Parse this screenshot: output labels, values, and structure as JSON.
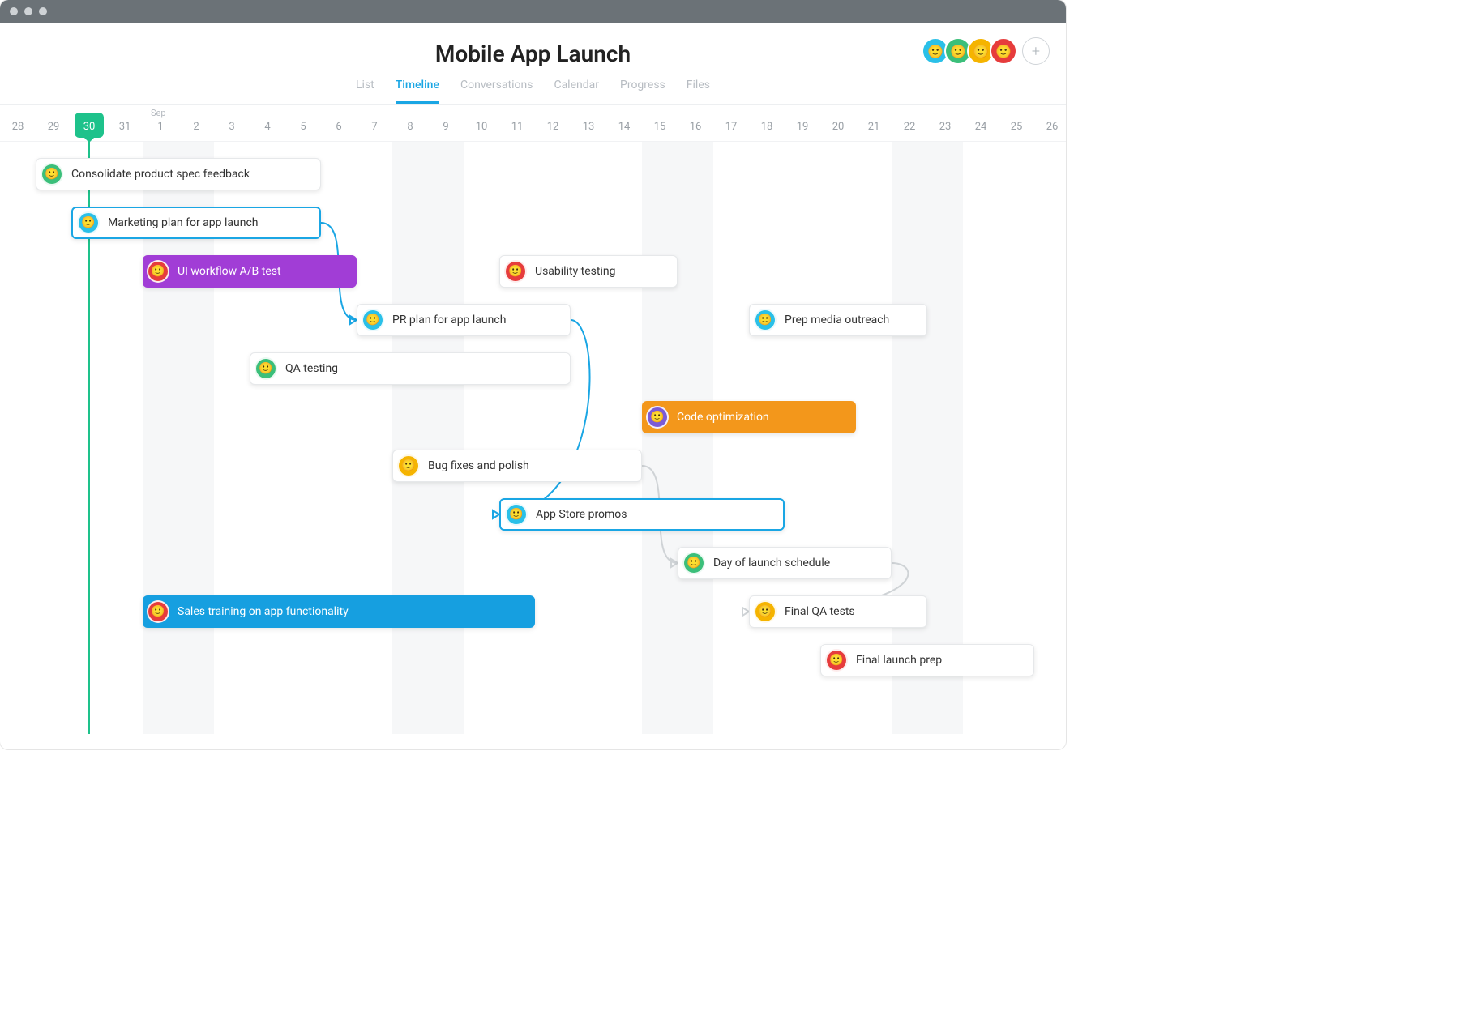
{
  "project_title": "Mobile App Launch",
  "tabs": [
    "List",
    "Timeline",
    "Conversations",
    "Calendar",
    "Progress",
    "Files"
  ],
  "active_tab": "Timeline",
  "month_label": "Sep",
  "dates": [
    {
      "label": "28",
      "weekend": false
    },
    {
      "label": "29",
      "weekend": false
    },
    {
      "label": "30",
      "weekend": false,
      "today": true
    },
    {
      "label": "31",
      "weekend": false
    },
    {
      "label": "1",
      "weekend": true,
      "month_start": true
    },
    {
      "label": "2",
      "weekend": true
    },
    {
      "label": "3",
      "weekend": false
    },
    {
      "label": "4",
      "weekend": false
    },
    {
      "label": "5",
      "weekend": false
    },
    {
      "label": "6",
      "weekend": false
    },
    {
      "label": "7",
      "weekend": false
    },
    {
      "label": "8",
      "weekend": true
    },
    {
      "label": "9",
      "weekend": true
    },
    {
      "label": "10",
      "weekend": false
    },
    {
      "label": "11",
      "weekend": false
    },
    {
      "label": "12",
      "weekend": false
    },
    {
      "label": "13",
      "weekend": false
    },
    {
      "label": "14",
      "weekend": false
    },
    {
      "label": "15",
      "weekend": true
    },
    {
      "label": "16",
      "weekend": true
    },
    {
      "label": "17",
      "weekend": false
    },
    {
      "label": "18",
      "weekend": false
    },
    {
      "label": "19",
      "weekend": false
    },
    {
      "label": "20",
      "weekend": false
    },
    {
      "label": "21",
      "weekend": false
    },
    {
      "label": "22",
      "weekend": true
    },
    {
      "label": "23",
      "weekend": true
    },
    {
      "label": "24",
      "weekend": false
    },
    {
      "label": "25",
      "weekend": false
    },
    {
      "label": "26",
      "weekend": false
    }
  ],
  "members": [
    {
      "color": "#2ac0e8"
    },
    {
      "color": "#3bbf7a"
    },
    {
      "color": "#f5b400"
    },
    {
      "color": "#e63c3c"
    }
  ],
  "tasks": [
    {
      "id": "t1",
      "label": "Consolidate product spec feedback",
      "row": 0,
      "start": 1,
      "span": 8,
      "style": "white",
      "avatar": "#3bbf7a"
    },
    {
      "id": "t2",
      "label": "Marketing plan for app launch",
      "row": 1,
      "start": 2,
      "span": 7,
      "style": "highlight",
      "avatar": "#2ac0e8"
    },
    {
      "id": "t3",
      "label": "UI workflow A/B test",
      "row": 2,
      "start": 4,
      "span": 6,
      "style": "purple",
      "avatar": "#e63c3c"
    },
    {
      "id": "t4",
      "label": "Usability testing",
      "row": 2,
      "start": 14,
      "span": 5,
      "style": "white",
      "avatar": "#e63c3c"
    },
    {
      "id": "t5",
      "label": "PR plan for app launch",
      "row": 3,
      "start": 10,
      "span": 6,
      "style": "white",
      "avatar": "#2ac0e8"
    },
    {
      "id": "t6",
      "label": "Prep media outreach",
      "row": 3,
      "start": 21,
      "span": 5,
      "style": "white",
      "avatar": "#2ac0e8"
    },
    {
      "id": "t7",
      "label": "QA testing",
      "row": 4,
      "start": 7,
      "span": 9,
      "style": "white",
      "avatar": "#3bbf7a"
    },
    {
      "id": "t8",
      "label": "Code optimization",
      "row": 5,
      "start": 18,
      "span": 6,
      "style": "orange",
      "avatar": "#7b5bd6"
    },
    {
      "id": "t9",
      "label": "Bug fixes and polish",
      "row": 6,
      "start": 11,
      "span": 7,
      "style": "white",
      "avatar": "#f5b400"
    },
    {
      "id": "t10",
      "label": "App Store promos",
      "row": 7,
      "start": 14,
      "span": 8,
      "style": "highlight",
      "avatar": "#2ac0e8"
    },
    {
      "id": "t11",
      "label": "Day of launch schedule",
      "row": 8,
      "start": 19,
      "span": 6,
      "style": "white",
      "avatar": "#3bbf7a"
    },
    {
      "id": "t12",
      "label": "Sales training on app functionality",
      "row": 9,
      "start": 4,
      "span": 11,
      "style": "blue",
      "avatar": "#e63c3c"
    },
    {
      "id": "t13",
      "label": "Final QA tests",
      "row": 9,
      "start": 21,
      "span": 5,
      "style": "white",
      "avatar": "#f5b400"
    },
    {
      "id": "t14",
      "label": "Final launch prep",
      "row": 10,
      "start": 23,
      "span": 6,
      "style": "white",
      "avatar": "#e63c3c"
    }
  ],
  "connectors": [
    {
      "from": "t2",
      "to": "t5",
      "color": "blue"
    },
    {
      "from": "t5",
      "to": "t10",
      "color": "blue"
    },
    {
      "from": "t9",
      "to": "t11",
      "color": "grey"
    },
    {
      "from": "t11",
      "to": "t13",
      "color": "grey"
    }
  ]
}
